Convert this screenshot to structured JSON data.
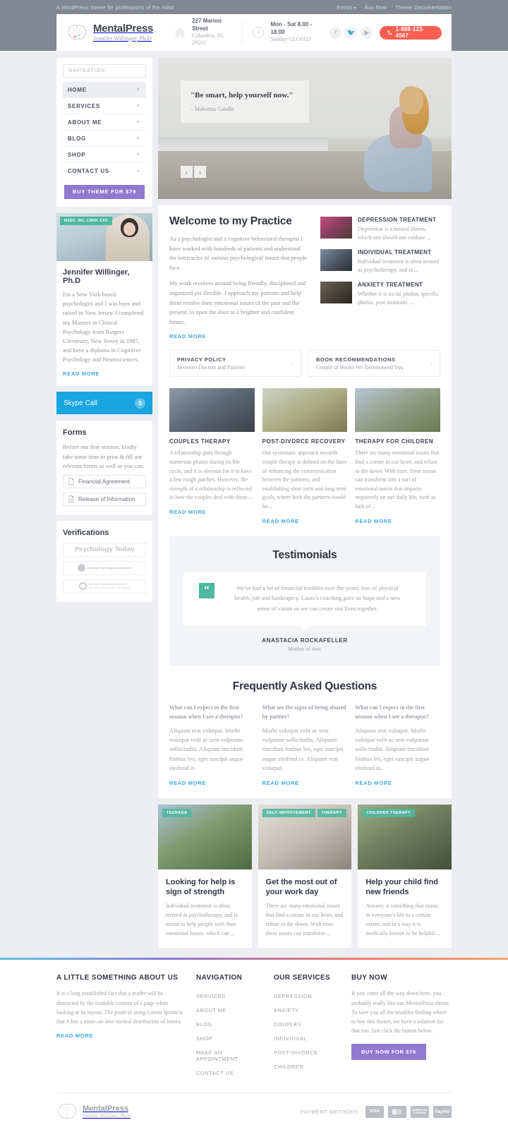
{
  "topbar": {
    "tagline": "A WordPress theme for professions of the mind",
    "links": [
      {
        "label": "Extras",
        "has_caret": true
      },
      {
        "label": "Buy Now",
        "has_caret": false
      },
      {
        "label": "Theme Documentation",
        "has_caret": false
      }
    ]
  },
  "header": {
    "brand_name": "MentalPress",
    "brand_sub": "Jennifer Willinger, Ph.D",
    "address_line1": "227 Marion Street",
    "address_line2": "Columbia, SC 29201",
    "hours_line1": "Mon - Sat 8.00 - 18.00",
    "hours_line2": "Sunday CLOSED",
    "socials": [
      "facebook-icon",
      "twitter-icon",
      "youtube-icon"
    ],
    "phone": "1-888-123-4567",
    "phone_color": "#fb5e52"
  },
  "sidebar": {
    "nav_title": "NAVIGATION",
    "nav_items": [
      {
        "label": "HOME",
        "active": true
      },
      {
        "label": "SERVICES",
        "active": false
      },
      {
        "label": "ABOUT ME",
        "active": false
      },
      {
        "label": "BLOG",
        "active": false
      },
      {
        "label": "SHOP",
        "active": false
      },
      {
        "label": "CONTACT US",
        "active": false
      }
    ],
    "buy_theme_label": "BUY THEME FOR $79",
    "buy_theme_color": "#9179cf",
    "profile": {
      "badge": "MSED, MA, LMHP, CPC",
      "badge_color": "#4fb8a0",
      "name": "Jennifer Willinger, Ph.D",
      "bio": "I'm a New York based psychologist and I was born and raised in New Jersey. I completed my Masters in Clinical Psychology from Rutgers University, New Jersey in 1987, and have a diploma in Cognitive Psychology and Neurosciences.",
      "read_more": "READ MORE"
    },
    "skype": {
      "label": "Skype Call",
      "color": "#19a5e0",
      "icon": "skype-icon"
    },
    "forms": {
      "title": "Forms",
      "text": "Before our first session, kindly take some time to print & fill out relevant forms as well as you can.",
      "items": [
        {
          "label": "Financial Agreement"
        },
        {
          "label": "Release of Information"
        }
      ]
    },
    "verifications": {
      "title": "Verifications",
      "items": [
        {
          "name": "Psychology Today"
        },
        {
          "name": "American Psychological Association"
        },
        {
          "name": "American Counseling Association",
          "tagline": "Your Source. Your Resource. Your Purpose."
        }
      ]
    }
  },
  "slider": {
    "quote": "\"Be smart, help yourself now.\"",
    "author": "– Mahatma Gandhi",
    "prev": "‹",
    "next": "›"
  },
  "welcome": {
    "title": "Welcome to my Practice",
    "paragraph1": "As a psychologist and a cognitive behavioral therapist I have worked with hundreds of patients and understand the intricacies of various psychological issues that people face.",
    "paragraph2": "My work revolves around being friendly, disciplined and organized yet flexible. I approach my patients and help them resolve their emotional issues of the past and the present, to open the door to a brighter and confident future.",
    "read_more": "READ MORE",
    "treatments": [
      {
        "title": "DEPRESSION TREATMENT",
        "text": "Depression is a mental illness, which one should not confuse ..."
      },
      {
        "title": "INDIVIDUAL TREATMENT",
        "text": "Individual treatment is often termed as psychotherapy, and is ..."
      },
      {
        "title": "ANXIETY TREATMENT",
        "text": "Whether it is social phobia, specific phobia, post traumatic ..."
      }
    ]
  },
  "info_boxes": [
    {
      "title": "PRIVACY POLICY",
      "subtitle": "Between Doctors and Patients",
      "arrow": "›"
    },
    {
      "title": "BOOK RECOMMENDATIONS",
      "subtitle": "Couple of Books We Recommend You",
      "arrow": "›"
    }
  ],
  "services": [
    {
      "title": "COUPLES THERAPY",
      "text": "A relationship goes through numerous phases during its life cycle, and it is obvious for it to have a few rough patches. However, the strength of a relationship is reflected in how the couples deal with those ...",
      "read_more": "READ MORE"
    },
    {
      "title": "POST-DIVORCE RECOVERY",
      "text": "Our systematic approach towards couple therapy is defined on the lines of enhancing the communication between the partners, and establishing short term and long term goals, where both the partners would be...",
      "read_more": "READ MORE"
    },
    {
      "title": "THERAPY FOR CHILDREN",
      "text": "There are many emotional issues that find a corner in our heart, and refuse to die down. With time, these issues can transform into a sort of emotional tumor that impacts negatively on our daily life, such as lack of...",
      "read_more": "READ MORE"
    }
  ],
  "testimonials": {
    "title": "Testimonials",
    "quote_mark": "“",
    "quote": "We've had a lot of financial troubles over the years; loss of physical health, job and bankruptcy. Laura's coaching gave us hope and a new sense of vision so we can create our lives together.",
    "name": "ANASTACIA ROCKAFELLER",
    "role": "Mother of two."
  },
  "faq": {
    "title": "Frequently Asked Questions",
    "items": [
      {
        "question": "What can I expect in the first session when I see a therapist?",
        "answer": "Aliquam erat volutpat. Morbi volutpat velit ac sem vulputate sollicitudin. Aliquam tincidunt finibus leo, eget suscipit augue eleifend in.",
        "read_more": "READ MORE"
      },
      {
        "question": "What are the signs of being abused by partner?",
        "answer": "Morbi volutpat velit ac sem vulputate sollicitudin. Aliquam tincidunt finibus leo, eget suscipit augue eleifend in. Aliquam erat volutpat.",
        "read_more": "READ MORE"
      },
      {
        "question": "What can I expect in the first session when I see a therapist?",
        "answer": "Aliquam erat volutpat. Morbi volutpat velit ac sem vulputate sollicitudin. Aliquam tincidunt finibus leo, eget suscipit augue eleifend in.",
        "read_more": "READ MORE"
      }
    ]
  },
  "blog": [
    {
      "tags": [
        "TEENAGE"
      ],
      "title": "Looking for help is sign of strength",
      "excerpt": "Individual treatment is often termed as psychotherapy, and is meant to help people with their emotional issues, which can ..."
    },
    {
      "tags": [
        "SELF IMPROVEMENT",
        "THERAPY"
      ],
      "title": "Get the most out of your work day",
      "excerpt": "There are many emotional issues that find a corner in our heart, and refuse to die down. With time, these issues can transform ..."
    },
    {
      "tags": [
        "CHILDREN THERAPY"
      ],
      "title": "Help your child find new friends",
      "excerpt": "Anxiety is something that exists in everyone's life to a certain extent, and in a way it is medically known to be helpful ..."
    }
  ],
  "footer": {
    "about_title": "A LITTLE SOMETHING ABOUT US",
    "about_text": "It is a long established fact that a reader will be distracted by the readable content of a page when looking at its layout. The point of using Lorem Ipsum is that it has a more–or–less normal distribution of letters.",
    "about_read_more": "READ MORE",
    "nav_title": "NAVIGATION",
    "nav_items": [
      "SERVICES",
      "ABOUT ME",
      "BLOG",
      "SHOP",
      "MAKE AN APPOINTMENT",
      "CONTACT US"
    ],
    "services_title": "OUR SERVICES",
    "services_items": [
      "DEPRESSION",
      "ANXIETY",
      "COUPLES",
      "INDIVIDUAL",
      "POST-DIVORCE",
      "CHILDREN"
    ],
    "buy_title": "BUY NOW",
    "buy_text": "If you come all the way down here, you probably really like our MentalPress theme. To save you all the troubles finding where to buy this theme, we have a solution for that too. Just click the button below.",
    "buy_button": "BUY NOW FOR $79",
    "brand_name": "MentalPress",
    "brand_sub": "Jennifer Willinger, Ph.D",
    "payment_label": "PAYMENT METHODS",
    "payments": [
      "VISA",
      "MASTERCARD",
      "AMERICAN EXPRESS",
      "PayPal"
    ]
  }
}
